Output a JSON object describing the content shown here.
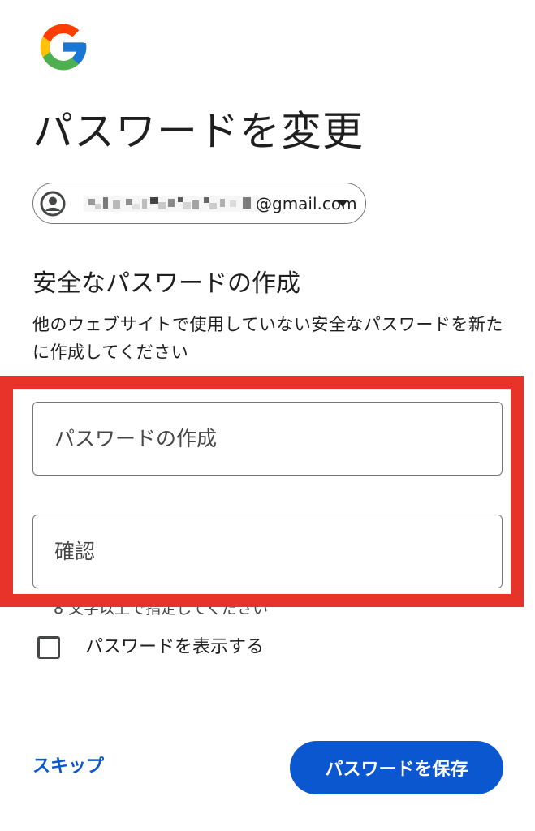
{
  "header": {
    "logo_icon": "google-g-logo-icon",
    "title": "パスワードを変更"
  },
  "account": {
    "avatar_icon": "account-circle-icon",
    "email_visible_suffix": "@gmail.com",
    "dropdown_icon": "caret-down-icon"
  },
  "section": {
    "heading": "安全なパスワードの作成",
    "description": "他のウェブサイトで使用していない安全なパスワードを新たに作成してください"
  },
  "form": {
    "create_password_placeholder": "パスワードの作成",
    "confirm_placeholder": "確認",
    "hint": "8 文字以上で指定してください",
    "show_password_label": "パスワードを表示する",
    "show_password_checked": false
  },
  "actions": {
    "skip_label": "スキップ",
    "save_label": "パスワードを保存"
  },
  "colors": {
    "accent": "#0b57d0",
    "highlight_annotation": "#e8332a",
    "text": "#1f1f1f",
    "outline": "#747775"
  }
}
